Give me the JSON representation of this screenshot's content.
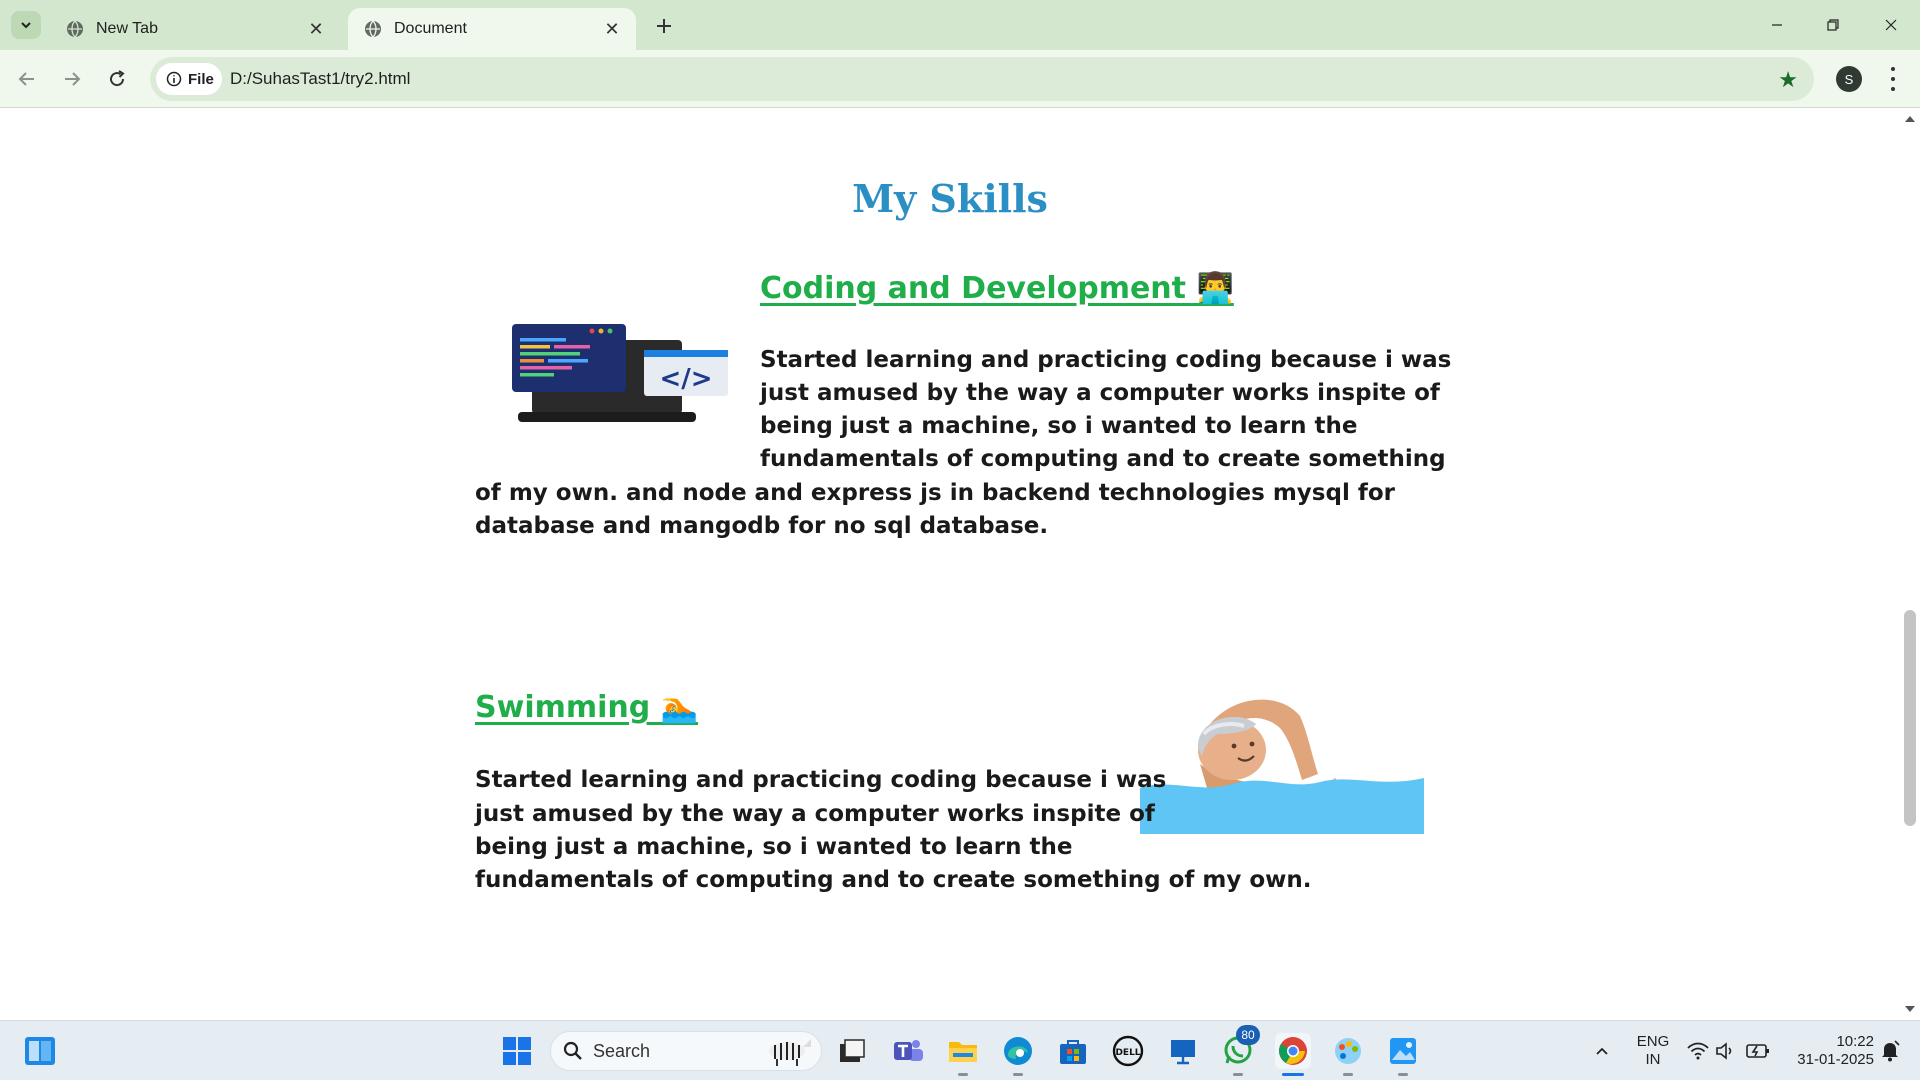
{
  "browser": {
    "tabs": [
      {
        "title": "New Tab"
      },
      {
        "title": "Document"
      }
    ],
    "omnibox": {
      "chip_label": "File",
      "url": "D:/SuhasTast1/try2.html"
    },
    "profile_initial": "S"
  },
  "page": {
    "title": "My Skills",
    "sections": [
      {
        "heading": "Coding and Development 👨‍💻",
        "lines": [
          "Started learning and practicing coding because i was",
          "just amused by the way a computer works inspite of",
          "being just a machine, so i wanted to learn the",
          "fundamentals of computing and to create something",
          "of my own. and node and express js in backend technologies mysql for",
          "database and mangodb for no sql database."
        ],
        "image_icon": "laptop-code-illustration"
      },
      {
        "heading": "Swimming 🏊",
        "lines": [
          "Started learning and practicing coding because i was",
          "just amused by the way a computer works inspite of",
          "being just a machine, so i wanted to learn the",
          "fundamentals of computing and to create something of my own."
        ],
        "image_icon": "swimmer-illustration"
      }
    ]
  },
  "taskbar": {
    "search_placeholder": "Search",
    "whatsapp_badge": "80",
    "language": "ENG",
    "region": "IN",
    "time": "10:22",
    "date": "31-01-2025"
  },
  "colors": {
    "heading_blue": "#2b8fc4",
    "section_green": "#1fae49",
    "tabbar_bg": "#d3e7ce",
    "toolbar_bg": "#f0f8ee"
  }
}
